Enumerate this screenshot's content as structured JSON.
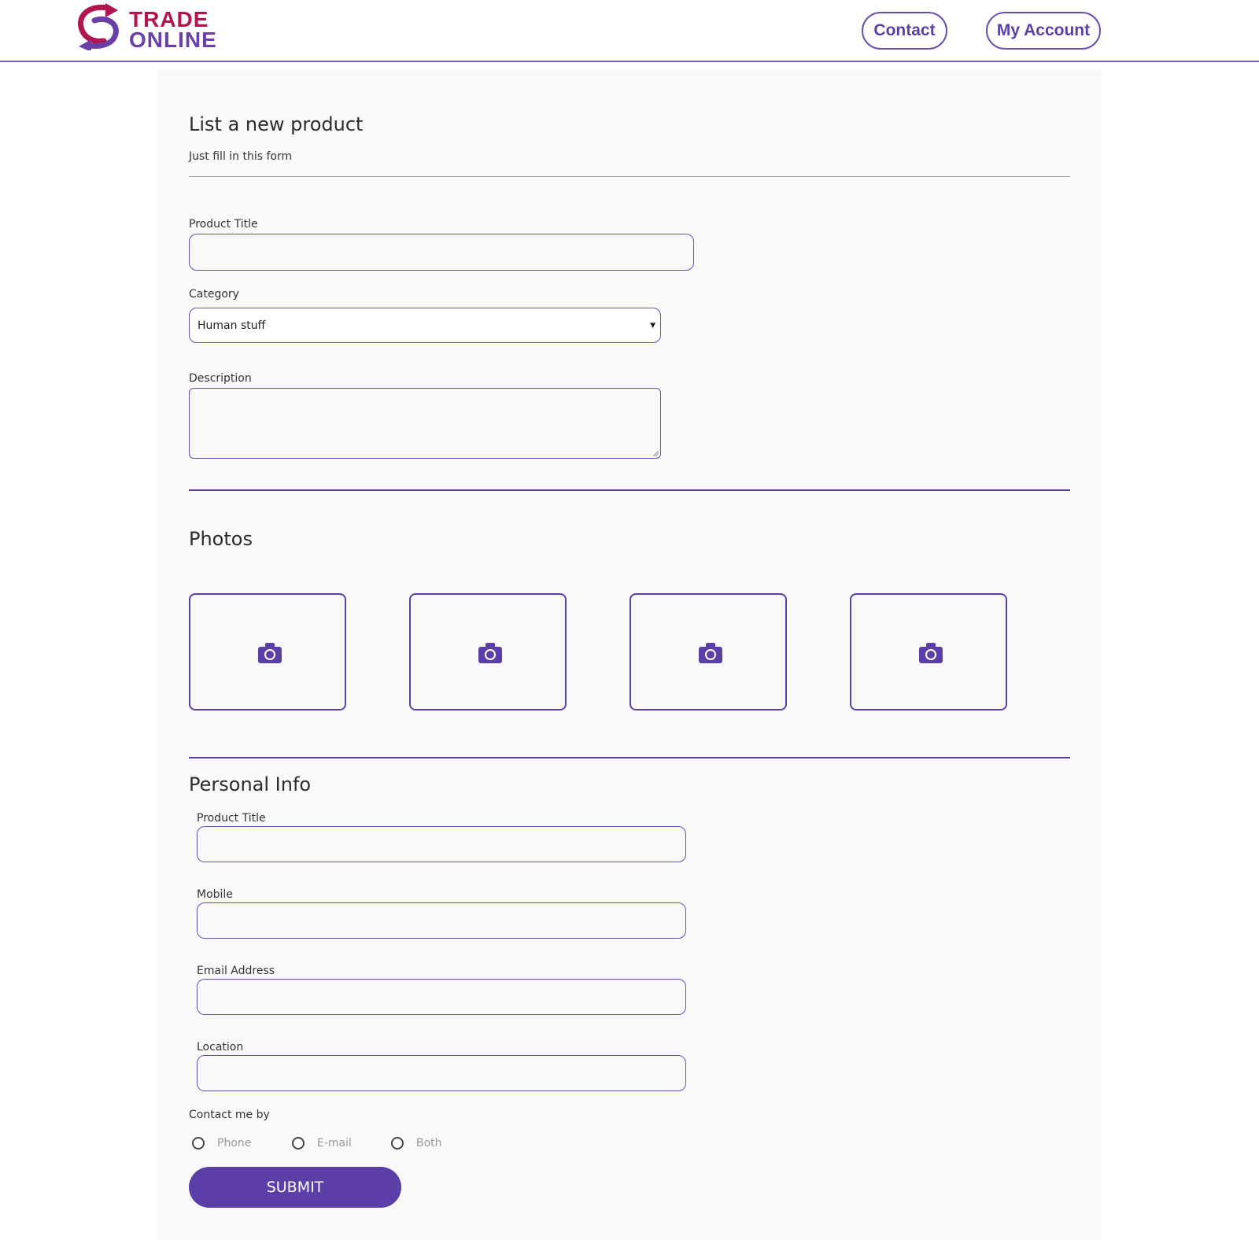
{
  "header": {
    "logo_line1": "TRADE",
    "logo_line2": "ONLINE",
    "nav": {
      "contact": "Contact",
      "account": "My Account"
    }
  },
  "form": {
    "title": "List a new product",
    "subtitle": "Just fill in this form",
    "product_title_label": "Product Title",
    "product_title_value": "",
    "category_label": "Category",
    "category_selected": "Human stuff",
    "description_label": "Description",
    "description_value": ""
  },
  "photos": {
    "heading": "Photos",
    "slots": [
      "camera-icon",
      "camera-icon",
      "camera-icon",
      "camera-icon"
    ]
  },
  "personal": {
    "heading": "Personal Info",
    "fields": [
      {
        "label": "Product Title",
        "value": ""
      },
      {
        "label": "Mobile",
        "value": ""
      },
      {
        "label": "Email Address",
        "value": ""
      },
      {
        "label": "Location",
        "value": ""
      }
    ],
    "contact_label": "Contact me by",
    "contact_options": [
      "Phone",
      "E-mail",
      "Both"
    ]
  },
  "submit_label": "SUBMIT",
  "colors": {
    "accent": "#5b3fa6",
    "logo_magenta": "#b0154f",
    "panel_bg": "#f9f9f9"
  }
}
